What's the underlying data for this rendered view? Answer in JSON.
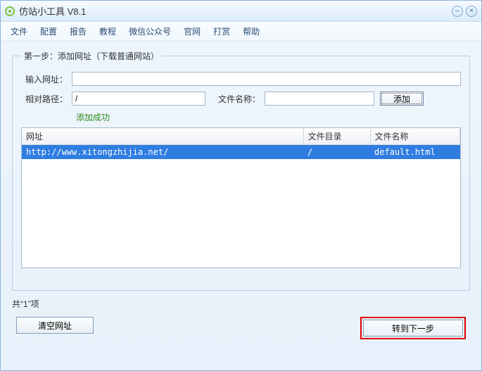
{
  "titlebar": {
    "title": "仿站小工具 V8.1"
  },
  "menu": {
    "file": "文件",
    "config": "配置",
    "report": "报告",
    "tutorial": "教程",
    "wechat": "微信公众号",
    "website": "官网",
    "donate": "打赏",
    "help": "帮助"
  },
  "group": {
    "legend": "第一步：添加网址（下载普通网站）"
  },
  "form": {
    "url_label": "输入网址：",
    "url_value": "",
    "path_label": "相对路径：",
    "path_value": "/",
    "filename_label": "文件名称：",
    "filename_value": "",
    "add_btn": "添加",
    "status": "添加成功"
  },
  "table": {
    "headers": {
      "url": "网址",
      "dir": "文件目录",
      "file": "文件名称"
    },
    "rows": [
      {
        "url": "http://www.xitongzhijia.net/",
        "dir": "/",
        "file": "default.html"
      }
    ]
  },
  "footer": {
    "count_prefix": "共“",
    "count_value": "1",
    "count_suffix": "”项",
    "clear_btn": "清空网址",
    "next_btn": "转到下一步"
  }
}
